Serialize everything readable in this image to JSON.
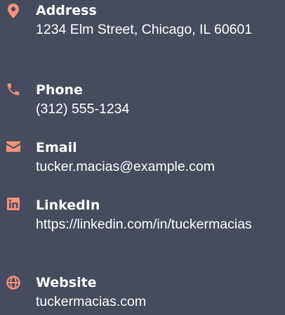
{
  "contacts": [
    {
      "label": "Address",
      "value": "1234 Elm Street, Chicago, IL 60601",
      "icon": "map-pin-icon"
    },
    {
      "label": "Phone",
      "value": "(312) 555-1234",
      "icon": "phone-icon"
    },
    {
      "label": "Email",
      "value": "tucker.macias@example.com",
      "icon": "envelope-icon"
    },
    {
      "label": "LinkedIn",
      "value": "https://linkedin.com/in/tuckermacias",
      "icon": "linkedin-icon"
    },
    {
      "label": "Website",
      "value": "tuckermacias.com",
      "icon": "globe-icon"
    }
  ],
  "colors": {
    "background": "#464b5d",
    "icon_accent": "#f0927a",
    "text": "#ffffff"
  }
}
